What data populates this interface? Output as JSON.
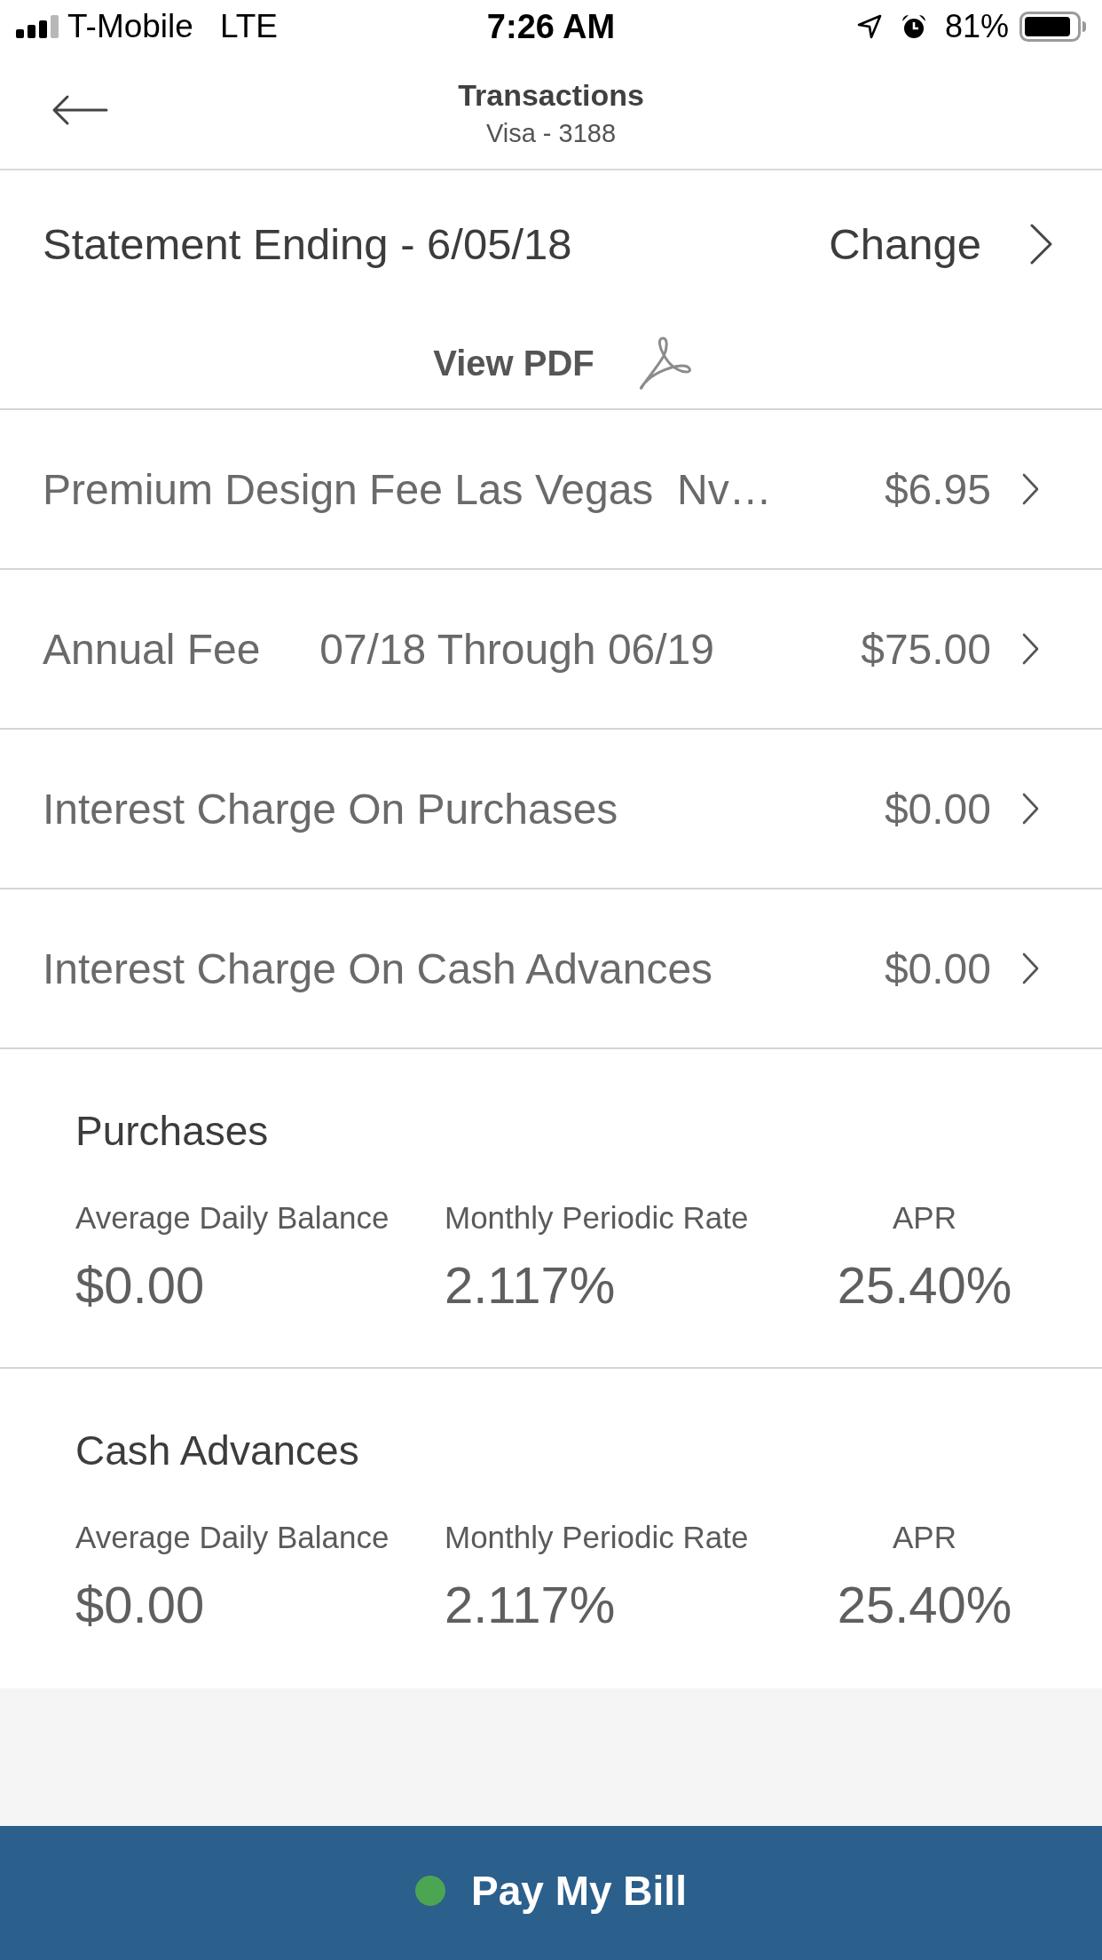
{
  "status_bar": {
    "carrier": "T-Mobile",
    "network": "LTE",
    "time": "7:26 AM",
    "battery": "81%"
  },
  "nav_bar": {
    "title": "Transactions",
    "subtitle": "Visa - 3188"
  },
  "statement": {
    "label": "Statement Ending - 6/05/18",
    "change_button": "Change",
    "pdf_link": "View PDF"
  },
  "transactions": [
    {
      "description": "Premium Design Fee Las Vegas  Nv…",
      "amount": "$6.95"
    },
    {
      "description": "Annual Fee     07/18 Through 06/19",
      "amount": "$75.00"
    },
    {
      "description": "Interest Charge On Purchases",
      "amount": "$0.00"
    },
    {
      "description": "Interest Charge On Cash Advances",
      "amount": "$0.00"
    }
  ],
  "rate_sections": [
    {
      "title": "Purchases",
      "metrics": [
        {
          "label": "Average Daily Balance",
          "value": "$0.00"
        },
        {
          "label": "Monthly Periodic Rate",
          "value": "2.117%"
        },
        {
          "label": "APR",
          "value": "25.40%"
        }
      ]
    },
    {
      "title": "Cash Advances",
      "metrics": [
        {
          "label": "Average Daily Balance",
          "value": "$0.00"
        },
        {
          "label": "Monthly Periodic Rate",
          "value": "2.117%"
        },
        {
          "label": "APR",
          "value": "25.40%"
        }
      ]
    }
  ],
  "pay_button": {
    "label": "Pay My Bill"
  }
}
